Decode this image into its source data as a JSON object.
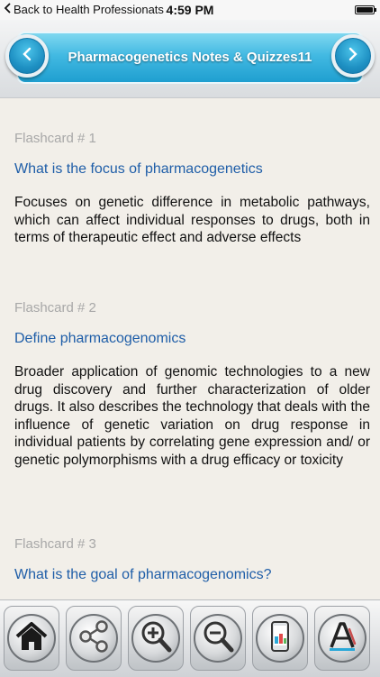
{
  "status_bar": {
    "back_label": "Back to Health Professionats",
    "time": "4:59 PM"
  },
  "header": {
    "title": "Pharmacogenetics Notes & Quizzes11"
  },
  "flashcards": [
    {
      "number": "Flashcard # 1",
      "question": "What is the focus of pharmacogenetics",
      "answer": "Focuses on genetic difference in metabolic pathways, which can affect individual responses to drugs, both in terms of therapeutic effect and adverse effects"
    },
    {
      "number": "Flashcard # 2",
      "question": "Define pharmacogenomics",
      "answer": "Broader application of genomic technologies to a new drug discovery and further characterization of older drugs. It also describes the technology that deals with the influence of genetic variation on drug response in individual patients by correlating gene expression and/ or genetic polymorphisms with a drug efficacy or toxicity"
    },
    {
      "number": "Flashcard # 3",
      "question": "What is the goal of pharmacogenomics?"
    }
  ],
  "toolbar": {
    "buttons": [
      {
        "icon": "home-icon"
      },
      {
        "icon": "share-icon"
      },
      {
        "icon": "zoom-in-icon"
      },
      {
        "icon": "zoom-out-icon"
      },
      {
        "icon": "phone-app-icon"
      },
      {
        "icon": "font-style-icon"
      }
    ]
  },
  "colors": {
    "banner": "#2fb0dc",
    "question": "#1f5ea8",
    "card_number": "#a8a8a8"
  }
}
